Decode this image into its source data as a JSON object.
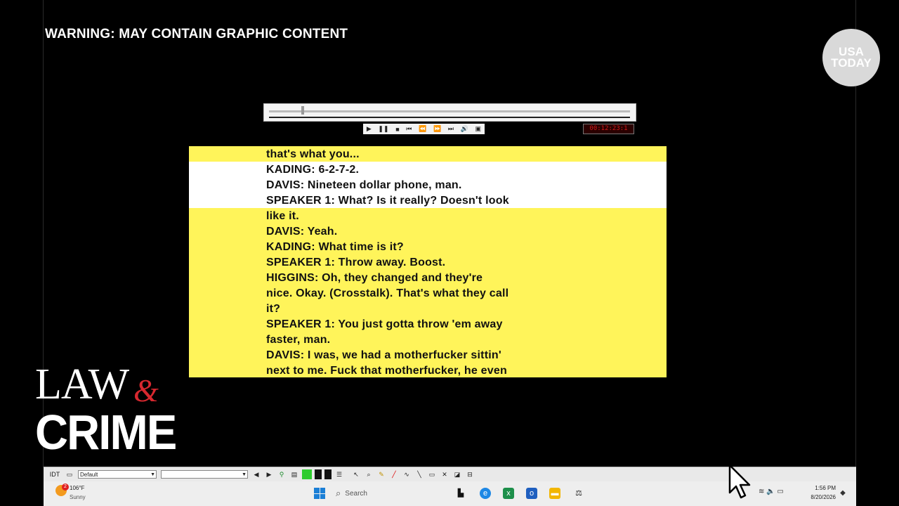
{
  "overlay": {
    "warning": "WARNING: MAY CONTAIN GRAPHIC CONTENT",
    "brand_line1": "USA",
    "brand_line2": "TODAY",
    "logo_top": "LAW",
    "logo_amp": "&",
    "logo_bottom": "CRIME"
  },
  "player": {
    "progress": 0.09,
    "controls": [
      "play-icon",
      "pause-icon",
      "stop-icon",
      "skip-back-icon",
      "rewind-icon",
      "fast-forward-icon",
      "skip-forward-icon",
      "volume-icon",
      "camera-icon"
    ],
    "time": "00:12:23:1"
  },
  "transcript": {
    "lines": [
      "that's what you...",
      "KADING: 6-2-7-2.",
      "DAVIS: Nineteen dollar phone, man.",
      "SPEAKER 1: What? Is it really? Doesn't look",
      "like it.",
      "DAVIS: Yeah.",
      "KADING: What time is it?",
      "SPEAKER 1: Throw away. Boost.",
      "HIGGINS: Oh, they changed and they're",
      "nice. Okay. (Crosstalk). That's what they call",
      "it?",
      "SPEAKER 1: You just gotta throw 'em away",
      "faster, man.",
      "DAVIS: I was, we had a motherfucker sittin'",
      "next to me. Fuck that motherfucker, he even"
    ],
    "highlight_color": "#fff45a"
  },
  "toolbar": {
    "id_label": "IDT",
    "layout_select": "Default",
    "second_select": ""
  },
  "taskbar": {
    "weather_badge": "2",
    "weather_temp": "106°F",
    "weather_condition": "Sunny",
    "search_label": "Search",
    "time": "1:56 PM",
    "date": "8/20/2026"
  }
}
